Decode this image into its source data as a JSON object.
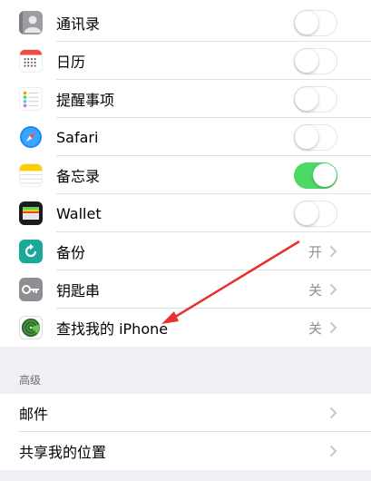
{
  "apps_list": [
    {
      "name": "contacts",
      "label": "通讯录",
      "icon": "contacts-icon",
      "control": "toggle",
      "on": false
    },
    {
      "name": "calendar",
      "label": "日历",
      "icon": "calendar-icon",
      "control": "toggle",
      "on": false
    },
    {
      "name": "reminders",
      "label": "提醒事项",
      "icon": "reminders-icon",
      "control": "toggle",
      "on": false
    },
    {
      "name": "safari",
      "label": "Safari",
      "icon": "safari-icon",
      "control": "toggle",
      "on": false
    },
    {
      "name": "notes",
      "label": "备忘录",
      "icon": "notes-icon",
      "control": "toggle",
      "on": true
    },
    {
      "name": "wallet",
      "label": "Wallet",
      "icon": "wallet-icon",
      "control": "toggle",
      "on": false
    },
    {
      "name": "backup",
      "label": "备份",
      "icon": "backup-icon",
      "control": "chevron",
      "value": "开"
    },
    {
      "name": "keychain",
      "label": "钥匙串",
      "icon": "key-icon",
      "control": "chevron",
      "value": "关"
    },
    {
      "name": "find-my-iphone",
      "label": "查找我的 iPhone",
      "icon": "radar-icon",
      "control": "chevron",
      "value": "关"
    }
  ],
  "advanced": {
    "header": "高级",
    "items": [
      {
        "name": "mail",
        "label": "邮件"
      },
      {
        "name": "share-location",
        "label": "共享我的位置"
      }
    ]
  },
  "colors": {
    "toggle_on": "#4cd964",
    "annotation_arrow": "#e8312f",
    "secondary_text": "#8e8e93"
  }
}
